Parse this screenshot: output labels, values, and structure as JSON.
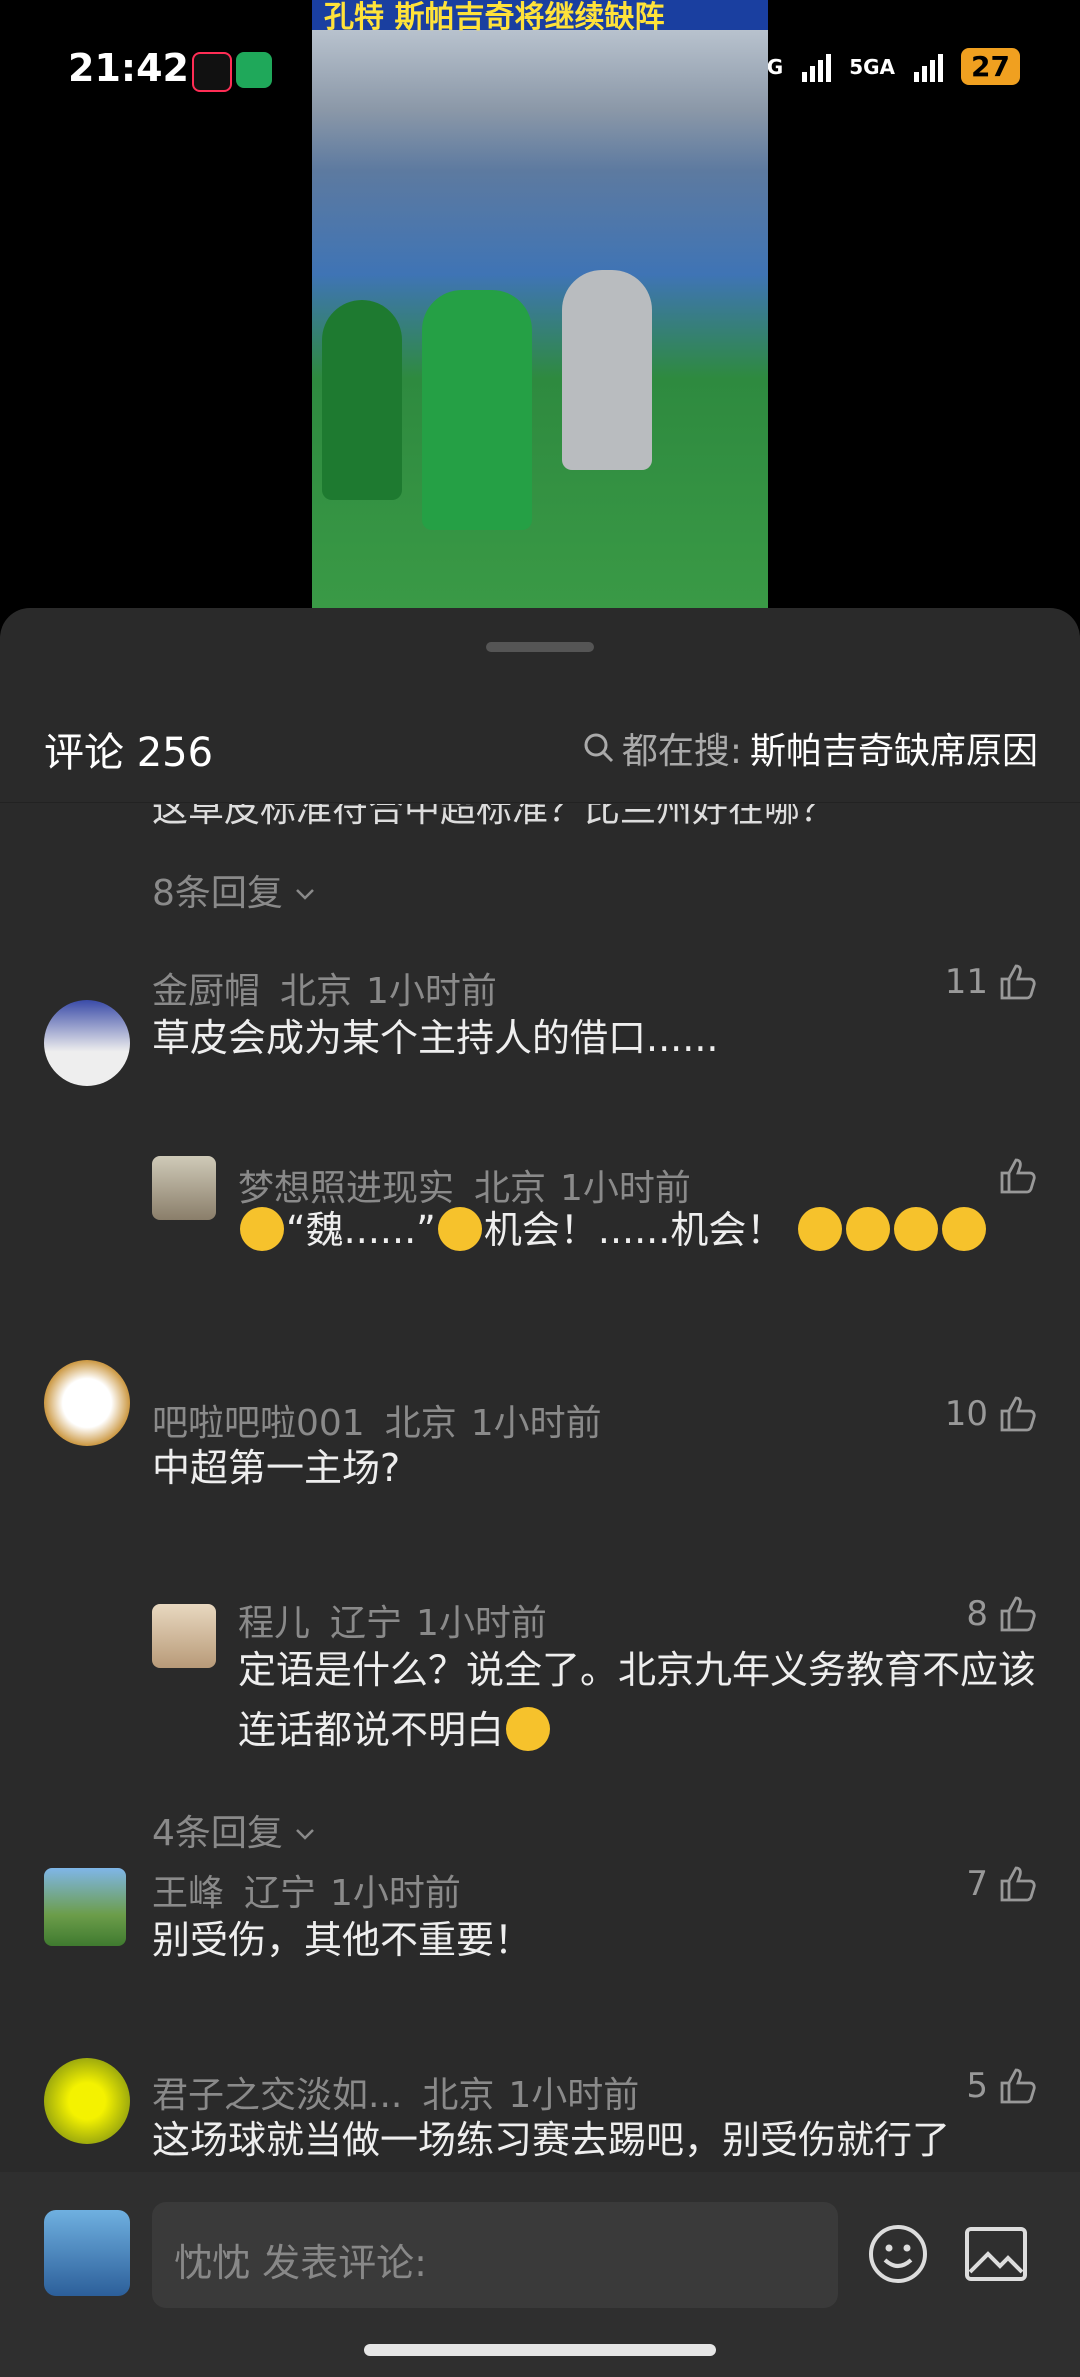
{
  "status_bar": {
    "time": "21:42",
    "network": "5G",
    "network2": "5GA",
    "battery": "27"
  },
  "video": {
    "title": "孔特 斯帕吉奇将继续缺阵"
  },
  "header": {
    "title": "评论 256",
    "search_prefix": "都在搜:",
    "search_keyword": "斯帕吉奇缺席原因"
  },
  "partial_text": "这草皮标准符合中超标准？比兰州好在哪？",
  "comments": [
    {
      "more": "8条回复"
    },
    {
      "name": "金厨帽",
      "location": "北京",
      "time": "1小时前",
      "likes": "11",
      "text": "草皮会成为某个主持人的借口......",
      "reply": {
        "name": "梦想照进现实",
        "location": "北京",
        "time": "1小时前",
        "likes": "",
        "text_a": "“魏......”",
        "text_b": "机会！......机会！"
      }
    },
    {
      "name": "吧啦吧啦001",
      "location": "北京",
      "time": "1小时前",
      "likes": "10",
      "text": "中超第一主场?",
      "reply": {
        "name": "程儿",
        "location": "辽宁",
        "time": "1小时前",
        "likes": "8",
        "text": "定语是什么？说全了。北京九年义务教育不应该连话都说不明白"
      },
      "more": "4条回复"
    },
    {
      "name": "王峰",
      "location": "辽宁",
      "time": "1小时前",
      "likes": "7",
      "text": "别受伤，其他不重要！"
    },
    {
      "name": "君子之交淡如...",
      "location": "北京",
      "time": "1小时前",
      "likes": "5",
      "text": "这场球就当做一场练习赛去踢吧，别受伤就行了"
    }
  ],
  "composer": {
    "placeholder": "忱忱 发表评论:"
  },
  "icons": [
    "search-icon",
    "chevron-down-icon",
    "thumb-up-icon",
    "emoji-icon",
    "image-icon",
    "alarm-icon",
    "bluetooth-icon",
    "wifi-icon",
    "signal-icon",
    "battery-icon"
  ]
}
